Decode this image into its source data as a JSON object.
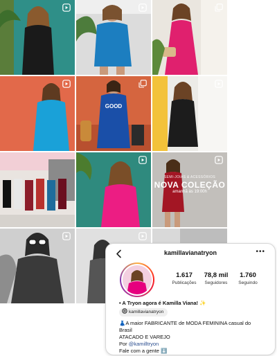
{
  "colors": {
    "accent": "#e6007e",
    "link": "#2a4d8f",
    "card_border": "#d7d7d7"
  },
  "grid": {
    "tiles": [
      {
        "icon": "reel-icon"
      },
      {
        "icon": "reel-icon"
      },
      {
        "icon": "carousel-icon"
      },
      {
        "icon": "reel-icon"
      },
      {
        "icon": "carousel-icon"
      },
      {
        "icon": "reel-icon"
      },
      {
        "icon": "none"
      },
      {
        "icon": "reel-icon"
      },
      {
        "icon": "reel-icon"
      },
      {
        "icon": "reel-icon"
      },
      {
        "icon": "reel-icon"
      },
      {
        "icon": "none"
      }
    ],
    "promo": {
      "small": "SEMI-JOIAS & ACESSÓRIOS",
      "title": "NOVA COLEÇÃO",
      "sub": "amanhã às 19:00h"
    }
  },
  "profile": {
    "back_icon": "chevron-left-icon",
    "username": "kamillavianatryon",
    "more_icon": "more-horizontal-icon",
    "stats": [
      {
        "value": "1.617",
        "label": "Publicações"
      },
      {
        "value": "78,8 mil",
        "label": "Seguidores"
      },
      {
        "value": "1.760",
        "label": "Seguindo"
      }
    ],
    "name_line": "• A Tryon agora é Kamilla Viana! ✨",
    "threads_handle": "kamillavianatryon",
    "bio": {
      "line1": "👗A maior FABRICANTE de MODA FEMININA casual do",
      "line2": "Brasil",
      "line3": "ATACADO E VAREJO",
      "line4_prefix": "Por ",
      "line4_link": "@kamilltryon",
      "line5": "Fale com a gente ⬇️"
    }
  }
}
